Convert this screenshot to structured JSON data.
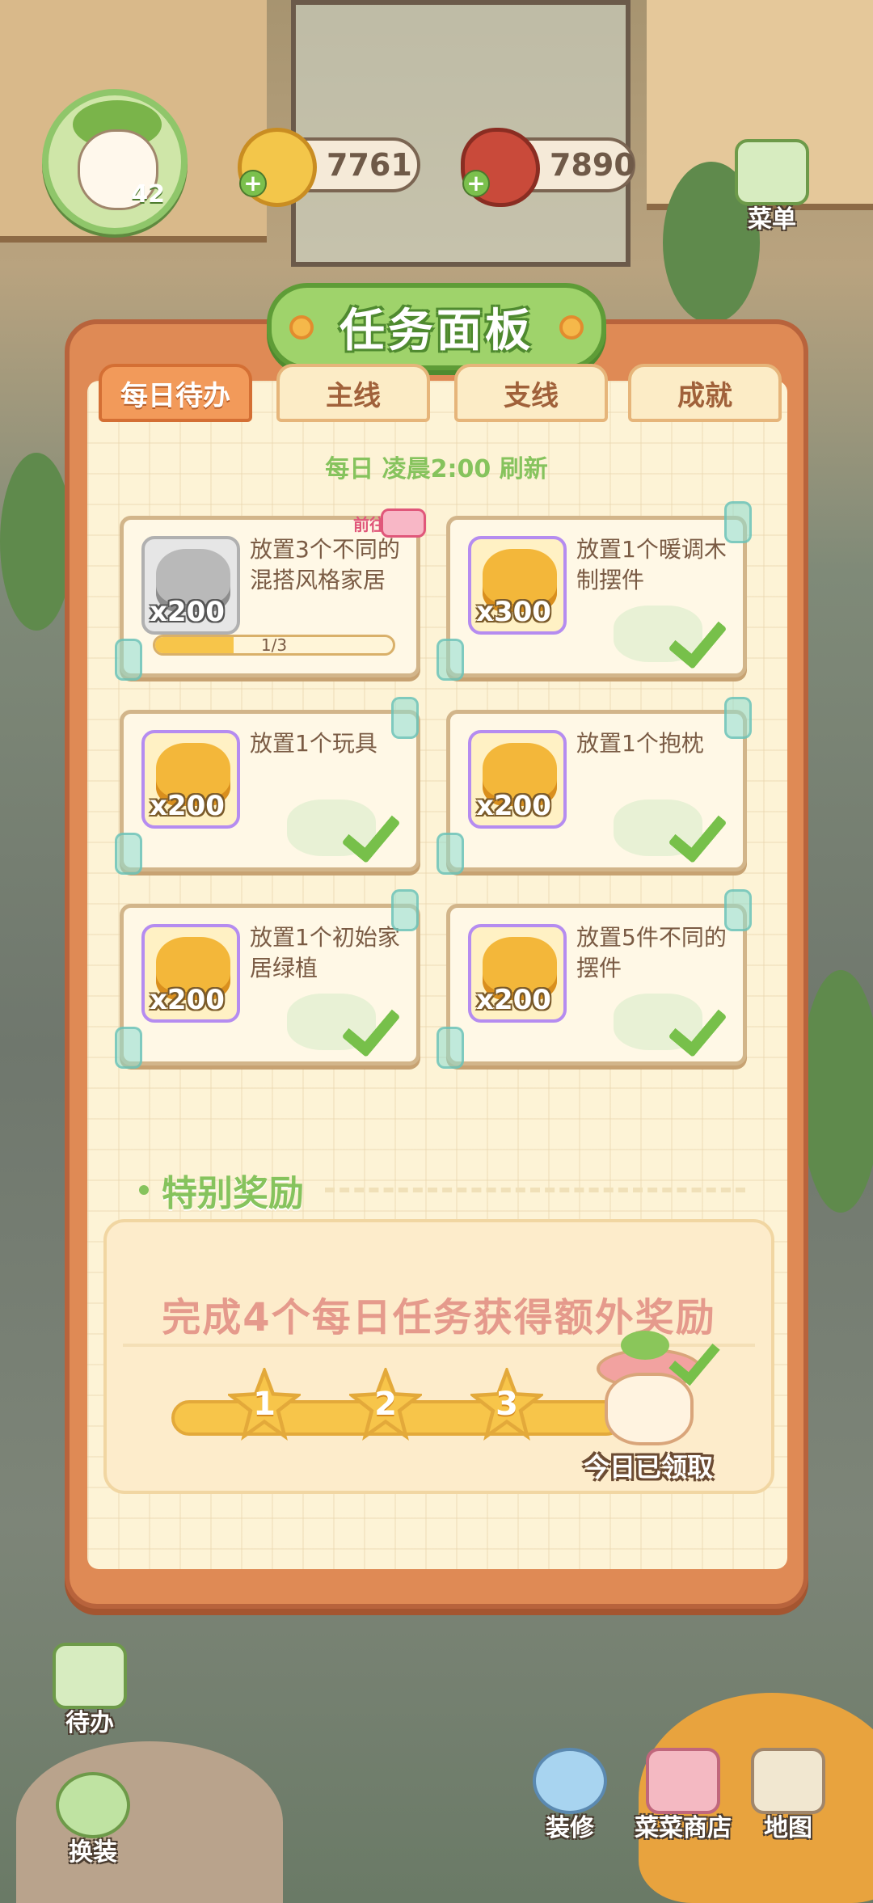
{
  "hud": {
    "level": "42",
    "coins": "7761",
    "meat": "7890"
  },
  "side_buttons": {
    "menu": "菜单",
    "todo": "待办",
    "dressup": "换装",
    "decorate": "装修",
    "shop": "菜菜商店",
    "map": "地图"
  },
  "panel": {
    "title": "任务面板",
    "tabs": [
      "每日待办",
      "主线",
      "支线",
      "成就"
    ],
    "active_tab": 0,
    "refresh_text": "每日 凌晨2:00 刷新",
    "tasks": [
      {
        "reward": "x200",
        "desc": "放置3个不同的混搭风格家居",
        "completed": false,
        "progress": "1/3",
        "progress_value": 0.33,
        "goto": "前往:",
        "reward_type": "grey"
      },
      {
        "reward": "x300",
        "desc": "放置1个暖调木制摆件",
        "completed": true,
        "reward_type": "gold"
      },
      {
        "reward": "x200",
        "desc": "放置1个玩具",
        "completed": true,
        "reward_type": "gold"
      },
      {
        "reward": "x200",
        "desc": "放置1个抱枕",
        "completed": true,
        "reward_type": "gold"
      },
      {
        "reward": "x200",
        "desc": "放置1个初始家居绿植",
        "completed": true,
        "reward_type": "gold"
      },
      {
        "reward": "x200",
        "desc": "放置5件不同的摆件",
        "completed": true,
        "reward_type": "gold"
      }
    ],
    "special": {
      "heading": "特别奖励",
      "goal": "完成4个每日任务获得额外奖励",
      "milestones": [
        "1",
        "2",
        "3"
      ],
      "claimed_text": "今日已领取"
    }
  },
  "colors": {
    "panel_border": "#df8a55",
    "tab_active": "#f29a5a",
    "accent_green": "#86c35d",
    "goal_text": "#e59a8c"
  }
}
